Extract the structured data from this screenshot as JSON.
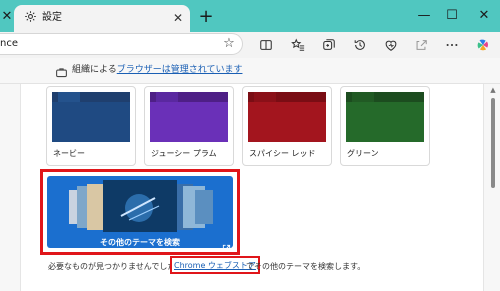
{
  "tab": {
    "title": "設定",
    "close": "✕",
    "partial_close": "✕"
  },
  "window": {
    "new_tab": "+",
    "minimize": "—",
    "maximize": "☐",
    "close": "✕"
  },
  "address": {
    "text": "nce"
  },
  "managed": {
    "prefix": "組織による",
    "link": "ブラウザーは管理されています"
  },
  "themes": [
    {
      "label": "ネービー",
      "top": "#1f3f6e",
      "tab": "#24528c",
      "body": "#1f4a82"
    },
    {
      "label": "ジューシー プラム",
      "top": "#4e1f86",
      "tab": "#5a28a0",
      "body": "#6a30b8"
    },
    {
      "label": "スパイシー レッド",
      "top": "#7a0d14",
      "tab": "#8a1018",
      "body": "#a3151e"
    },
    {
      "label": "グリーン",
      "top": "#1c4c1f",
      "tab": "#215a24",
      "body": "#256a2a"
    }
  ],
  "search_themes": {
    "label": "その他のテーマを検索"
  },
  "footer": {
    "prefix": "必要なものが見つかりませんでしたか",
    "link": "Chrome ウェブストア",
    "suffix": "でその他のテーマを検索します。"
  },
  "colors": {
    "titlebar": "#50c7c0",
    "highlight": "#e0151a",
    "accent": "#1b6fcf"
  }
}
